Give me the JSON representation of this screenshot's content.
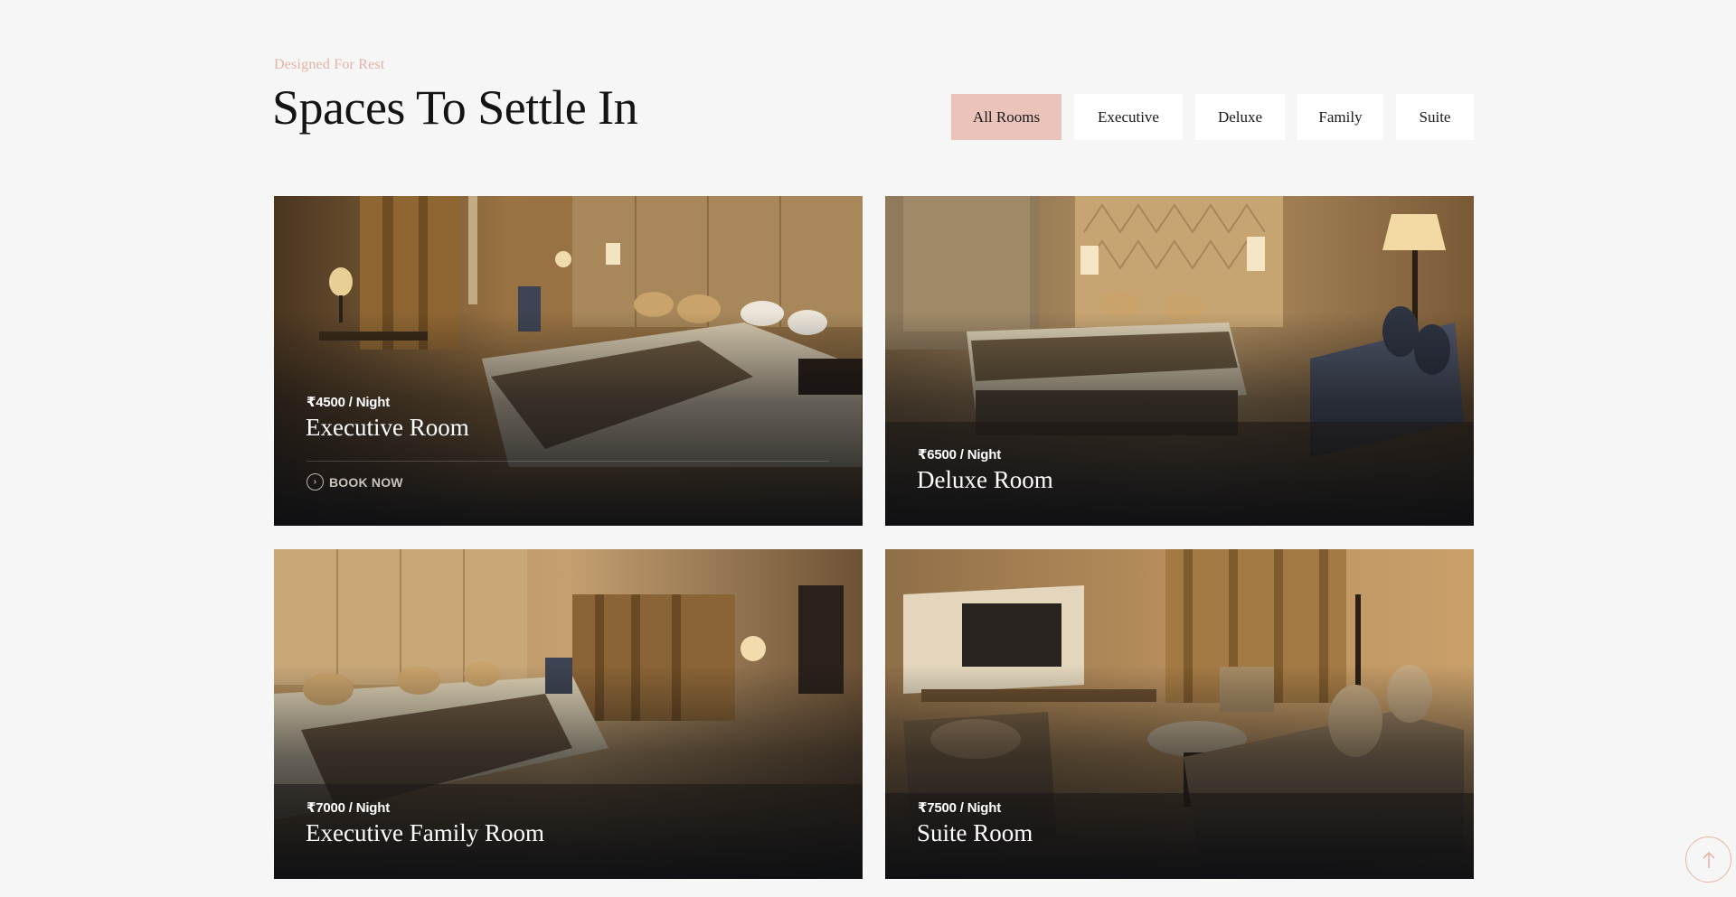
{
  "header": {
    "eyebrow": "Designed For Rest",
    "title": "Spaces To Settle In"
  },
  "filters": [
    {
      "label": "All Rooms",
      "active": true
    },
    {
      "label": "Executive",
      "active": false
    },
    {
      "label": "Deluxe",
      "active": false
    },
    {
      "label": "Family",
      "active": false
    },
    {
      "label": "Suite",
      "active": false
    }
  ],
  "rooms": [
    {
      "price": "₹4500 / Night",
      "name": "Executive Room",
      "cta": "BOOK NOW"
    },
    {
      "price": "₹6500 / Night",
      "name": "Deluxe Room"
    },
    {
      "price": "₹7000 / Night",
      "name": "Executive Family Room"
    },
    {
      "price": "₹7500 / Night",
      "name": "Suite Room"
    }
  ],
  "colors": {
    "accent": "#eac4bb",
    "eyebrow": "#e4b2a6",
    "background": "#f6f6f6"
  },
  "icons": {
    "book_now": "chevron-right-circle-icon",
    "scroll_top": "arrow-up-icon"
  }
}
